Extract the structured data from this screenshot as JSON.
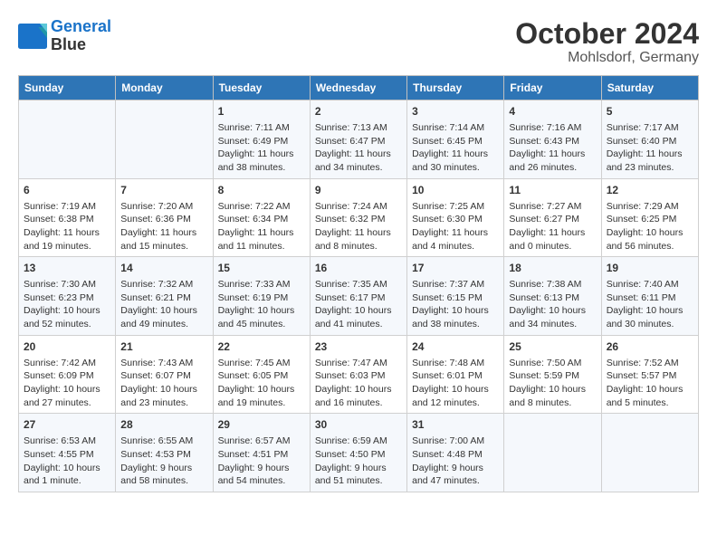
{
  "header": {
    "logo_line1": "General",
    "logo_line2": "Blue",
    "title": "October 2024",
    "subtitle": "Mohlsdorf, Germany"
  },
  "days_of_week": [
    "Sunday",
    "Monday",
    "Tuesday",
    "Wednesday",
    "Thursday",
    "Friday",
    "Saturday"
  ],
  "weeks": [
    [
      {
        "day": "",
        "info": ""
      },
      {
        "day": "",
        "info": ""
      },
      {
        "day": "1",
        "info": "Sunrise: 7:11 AM\nSunset: 6:49 PM\nDaylight: 11 hours and 38 minutes."
      },
      {
        "day": "2",
        "info": "Sunrise: 7:13 AM\nSunset: 6:47 PM\nDaylight: 11 hours and 34 minutes."
      },
      {
        "day": "3",
        "info": "Sunrise: 7:14 AM\nSunset: 6:45 PM\nDaylight: 11 hours and 30 minutes."
      },
      {
        "day": "4",
        "info": "Sunrise: 7:16 AM\nSunset: 6:43 PM\nDaylight: 11 hours and 26 minutes."
      },
      {
        "day": "5",
        "info": "Sunrise: 7:17 AM\nSunset: 6:40 PM\nDaylight: 11 hours and 23 minutes."
      }
    ],
    [
      {
        "day": "6",
        "info": "Sunrise: 7:19 AM\nSunset: 6:38 PM\nDaylight: 11 hours and 19 minutes."
      },
      {
        "day": "7",
        "info": "Sunrise: 7:20 AM\nSunset: 6:36 PM\nDaylight: 11 hours and 15 minutes."
      },
      {
        "day": "8",
        "info": "Sunrise: 7:22 AM\nSunset: 6:34 PM\nDaylight: 11 hours and 11 minutes."
      },
      {
        "day": "9",
        "info": "Sunrise: 7:24 AM\nSunset: 6:32 PM\nDaylight: 11 hours and 8 minutes."
      },
      {
        "day": "10",
        "info": "Sunrise: 7:25 AM\nSunset: 6:30 PM\nDaylight: 11 hours and 4 minutes."
      },
      {
        "day": "11",
        "info": "Sunrise: 7:27 AM\nSunset: 6:27 PM\nDaylight: 11 hours and 0 minutes."
      },
      {
        "day": "12",
        "info": "Sunrise: 7:29 AM\nSunset: 6:25 PM\nDaylight: 10 hours and 56 minutes."
      }
    ],
    [
      {
        "day": "13",
        "info": "Sunrise: 7:30 AM\nSunset: 6:23 PM\nDaylight: 10 hours and 52 minutes."
      },
      {
        "day": "14",
        "info": "Sunrise: 7:32 AM\nSunset: 6:21 PM\nDaylight: 10 hours and 49 minutes."
      },
      {
        "day": "15",
        "info": "Sunrise: 7:33 AM\nSunset: 6:19 PM\nDaylight: 10 hours and 45 minutes."
      },
      {
        "day": "16",
        "info": "Sunrise: 7:35 AM\nSunset: 6:17 PM\nDaylight: 10 hours and 41 minutes."
      },
      {
        "day": "17",
        "info": "Sunrise: 7:37 AM\nSunset: 6:15 PM\nDaylight: 10 hours and 38 minutes."
      },
      {
        "day": "18",
        "info": "Sunrise: 7:38 AM\nSunset: 6:13 PM\nDaylight: 10 hours and 34 minutes."
      },
      {
        "day": "19",
        "info": "Sunrise: 7:40 AM\nSunset: 6:11 PM\nDaylight: 10 hours and 30 minutes."
      }
    ],
    [
      {
        "day": "20",
        "info": "Sunrise: 7:42 AM\nSunset: 6:09 PM\nDaylight: 10 hours and 27 minutes."
      },
      {
        "day": "21",
        "info": "Sunrise: 7:43 AM\nSunset: 6:07 PM\nDaylight: 10 hours and 23 minutes."
      },
      {
        "day": "22",
        "info": "Sunrise: 7:45 AM\nSunset: 6:05 PM\nDaylight: 10 hours and 19 minutes."
      },
      {
        "day": "23",
        "info": "Sunrise: 7:47 AM\nSunset: 6:03 PM\nDaylight: 10 hours and 16 minutes."
      },
      {
        "day": "24",
        "info": "Sunrise: 7:48 AM\nSunset: 6:01 PM\nDaylight: 10 hours and 12 minutes."
      },
      {
        "day": "25",
        "info": "Sunrise: 7:50 AM\nSunset: 5:59 PM\nDaylight: 10 hours and 8 minutes."
      },
      {
        "day": "26",
        "info": "Sunrise: 7:52 AM\nSunset: 5:57 PM\nDaylight: 10 hours and 5 minutes."
      }
    ],
    [
      {
        "day": "27",
        "info": "Sunrise: 6:53 AM\nSunset: 4:55 PM\nDaylight: 10 hours and 1 minute."
      },
      {
        "day": "28",
        "info": "Sunrise: 6:55 AM\nSunset: 4:53 PM\nDaylight: 9 hours and 58 minutes."
      },
      {
        "day": "29",
        "info": "Sunrise: 6:57 AM\nSunset: 4:51 PM\nDaylight: 9 hours and 54 minutes."
      },
      {
        "day": "30",
        "info": "Sunrise: 6:59 AM\nSunset: 4:50 PM\nDaylight: 9 hours and 51 minutes."
      },
      {
        "day": "31",
        "info": "Sunrise: 7:00 AM\nSunset: 4:48 PM\nDaylight: 9 hours and 47 minutes."
      },
      {
        "day": "",
        "info": ""
      },
      {
        "day": "",
        "info": ""
      }
    ]
  ]
}
